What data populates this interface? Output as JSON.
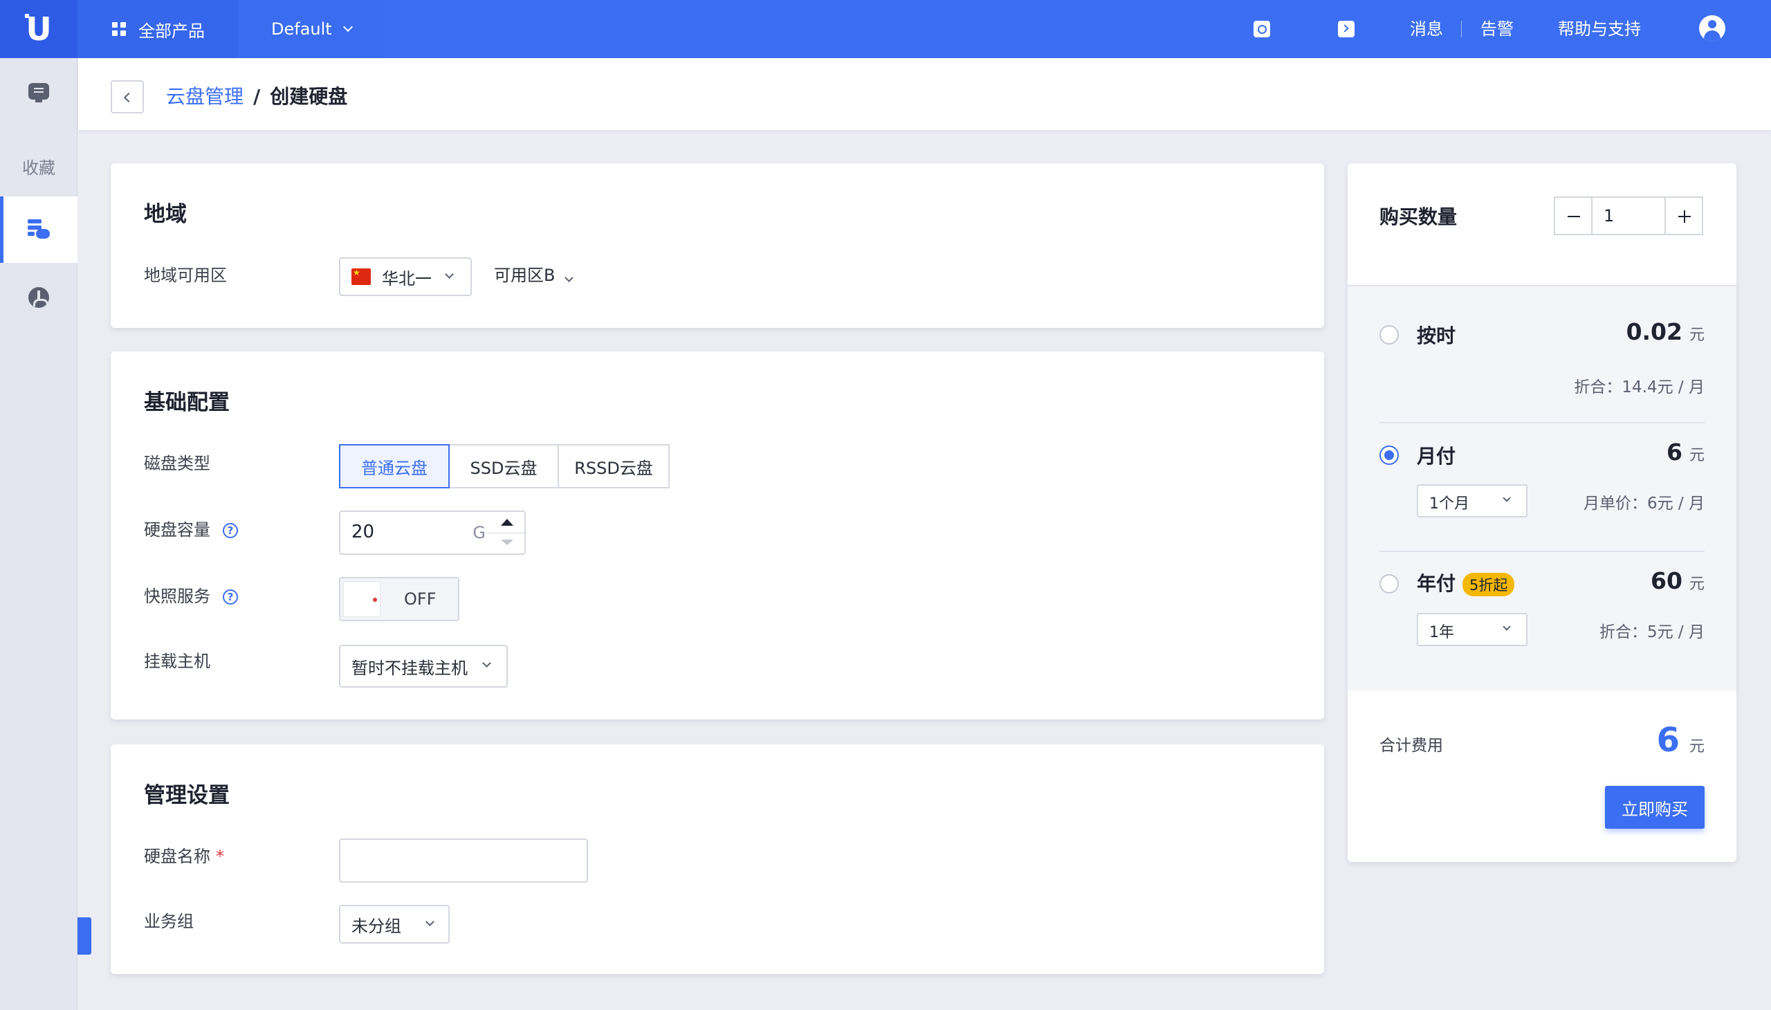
{
  "brand": {
    "logo_letter": "U"
  },
  "topbar": {
    "products_label": "全部产品",
    "project_label": "Default",
    "messages": "消息",
    "alerts": "告警",
    "help": "帮助与支持"
  },
  "sidebar": {
    "favorites": "收藏"
  },
  "breadcrumb": {
    "parent": "云盘管理",
    "sep": "/",
    "current": "创建硬盘"
  },
  "region": {
    "title": "地域",
    "label": "地域可用区",
    "region_value": "华北一",
    "zone_value": "可用区B"
  },
  "basic": {
    "title": "基础配置",
    "disk_type_label": "磁盘类型",
    "disk_types": [
      "普通云盘",
      "SSD云盘",
      "RSSD云盘"
    ],
    "disk_type_selected": "普通云盘",
    "capacity_label": "硬盘容量",
    "capacity_value": "20",
    "capacity_unit": "G",
    "snapshot_label": "快照服务",
    "snapshot_value": "OFF",
    "mount_label": "挂载主机",
    "mount_value": "暂时不挂载主机",
    "help_glyph": "?"
  },
  "manage": {
    "title": "管理设置",
    "name_label": "硬盘名称",
    "required_mark": "*",
    "name_value": "",
    "group_label": "业务组",
    "group_value": "未分组"
  },
  "order": {
    "qty_label": "购买数量",
    "qty_value": "1",
    "currency": "元",
    "plans": {
      "hourly": {
        "name": "按时",
        "price": "0.02",
        "note": "折合：14.4元 / 月",
        "selected": false
      },
      "monthly": {
        "name": "月付",
        "price": "6",
        "period": "1个月",
        "note": "月单价：6元 / 月",
        "selected": true
      },
      "yearly": {
        "name": "年付",
        "badge": "5折起",
        "price": "60",
        "period": "1年",
        "note": "折合：5元 / 月",
        "selected": false
      }
    },
    "total_label": "合计费用",
    "total_value": "6",
    "buy_label": "立即购买"
  },
  "colors": {
    "primary": "#3b6ef2",
    "badge": "#f5b800",
    "required": "#e23c3c"
  }
}
